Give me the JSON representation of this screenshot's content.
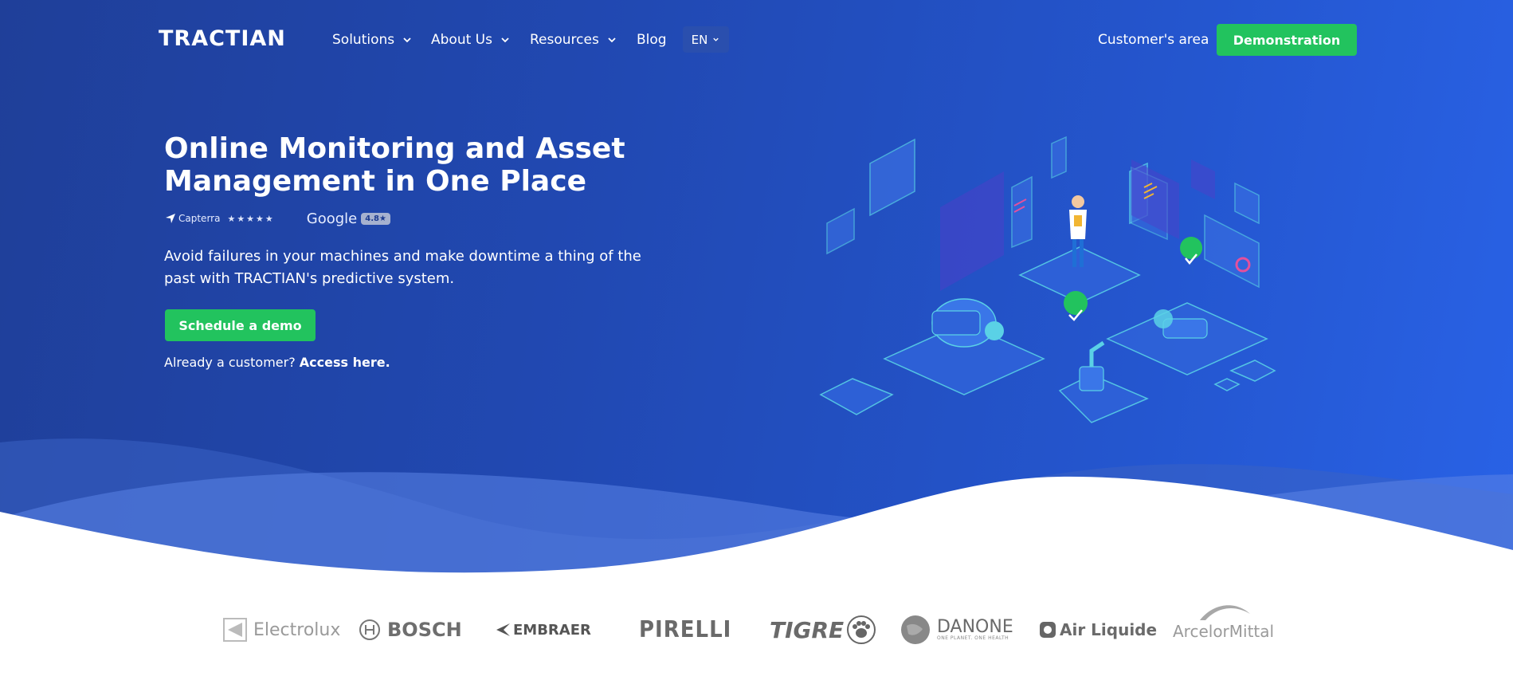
{
  "nav": {
    "logo": "TRACTIAN",
    "items": [
      {
        "label": "Solutions",
        "has_dropdown": true
      },
      {
        "label": "About Us",
        "has_dropdown": true
      },
      {
        "label": "Resources",
        "has_dropdown": true
      },
      {
        "label": "Blog",
        "has_dropdown": false
      }
    ],
    "language": "EN",
    "customer_area": "Customer's area",
    "demo_button": "Demonstration"
  },
  "hero": {
    "title": "Online Monitoring and Asset Management in One Place",
    "ratings": {
      "capterra_label": "Capterra",
      "capterra_stars": "★★★★★",
      "google_label": "Google",
      "google_score": "4.8★"
    },
    "subtitle": "Avoid failures in your machines and make downtime a thing of the past with TRACTIAN's predictive system.",
    "cta_button": "Schedule a demo",
    "already_customer": "Already a customer?",
    "access_link": "Access here."
  },
  "clients": {
    "logos": [
      {
        "name": "Electrolux",
        "icon": "electrolux-mark"
      },
      {
        "name": "BOSCH",
        "icon": "bosch-mark"
      },
      {
        "name": "EMBRAER",
        "icon": "embraer-mark"
      },
      {
        "name": "PIRELLI",
        "icon": "pirelli-wordmark"
      },
      {
        "name": "TIGRE",
        "icon": "paw-mark"
      },
      {
        "name": "DANONE",
        "tagline": "ONE PLANET. ONE HEALTH",
        "icon": "globe-mark"
      },
      {
        "name": "Air Liquide",
        "icon": "air-liquide-mark"
      },
      {
        "name": "ArcelorMittal",
        "icon": "swoosh-mark"
      }
    ]
  },
  "colors": {
    "hero_start": "#1f3f99",
    "hero_end": "#2962e6",
    "accent_green": "#22c35e",
    "illustration_teal": "#5ad1e6"
  }
}
